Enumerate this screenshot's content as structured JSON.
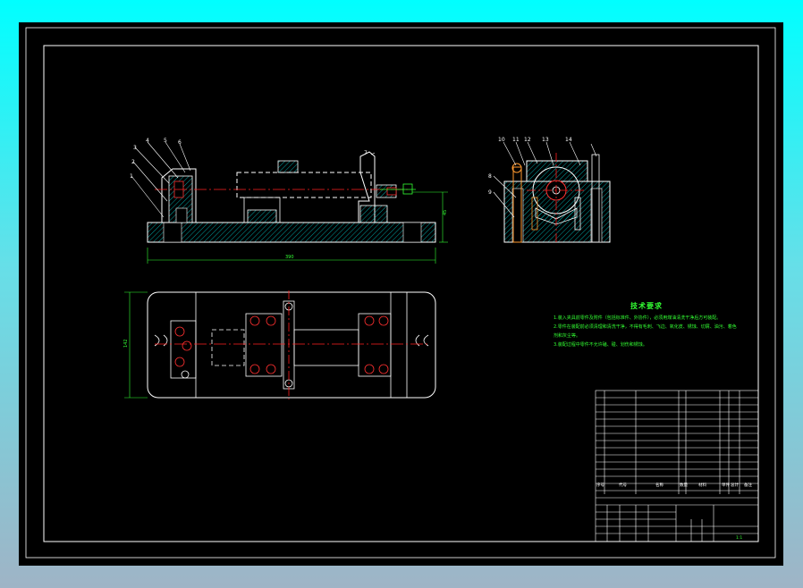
{
  "drawing": {
    "notes_title": "技术要求",
    "notes": [
      "1.装入夹具前零件及附件（包括标准件、外协件），必须用煤油清洗干净后方可装配。",
      "2.零件在装配前必须清理和清洗干净，不得有毛刺、飞边、氧化皮、锈蚀、切屑、油污、着色剂和灰尘等。",
      "3.装配过程中零件不允许磕、碰、划伤和锈蚀。"
    ],
    "balloons": [
      "1",
      "2",
      "3",
      "4",
      "5",
      "6",
      "7",
      "8",
      "9",
      "10",
      "11",
      "12",
      "13",
      "14"
    ],
    "dimension_labels": [
      "390",
      "45",
      "142"
    ],
    "title_block": {
      "header": [
        "序号",
        "代号",
        "名称",
        "数量",
        "材料",
        "单件",
        "总计",
        "备注"
      ],
      "scale": "1:1"
    }
  },
  "colors": {
    "background": "#000000",
    "outline": "#ffffff",
    "hatch": "#00ffff",
    "centerline": "#ff2020",
    "dimension": "#33ff33",
    "desktop_top": "#00ffff",
    "desktop_bottom": "#9fb4c6"
  }
}
